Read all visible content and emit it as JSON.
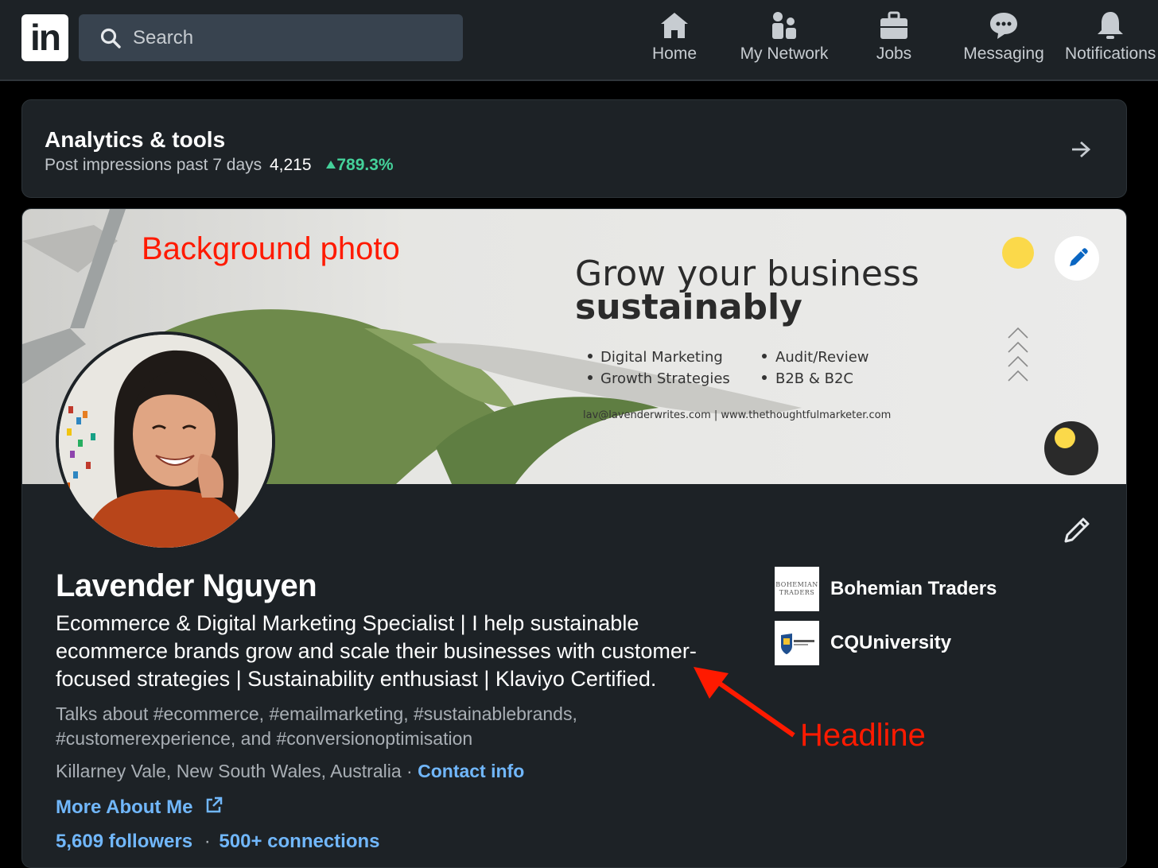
{
  "nav": {
    "logo_text": "in",
    "search_placeholder": "Search",
    "items": [
      {
        "label": "Home",
        "icon": "home-icon"
      },
      {
        "label": "My Network",
        "icon": "network-icon"
      },
      {
        "label": "Jobs",
        "icon": "briefcase-icon"
      },
      {
        "label": "Messaging",
        "icon": "chat-icon"
      },
      {
        "label": "Notifications",
        "icon": "bell-icon"
      }
    ]
  },
  "analytics": {
    "title": "Analytics & tools",
    "impressions_label": "Post impressions past 7 days",
    "impressions_value": "4,215",
    "impressions_change": "789.3%"
  },
  "banner": {
    "heading_line1": "Grow your business",
    "heading_line2": "sustainably",
    "services": [
      "Digital Marketing",
      "Growth Strategies",
      "Audit/Review",
      "B2B & B2C"
    ],
    "contact_line": "lav@lavenderwrites.com  | www.thethoughtfulmarketer.com"
  },
  "profile": {
    "name": "Lavender Nguyen",
    "headline": "Ecommerce & Digital Marketing Specialist | I help sustainable ecommerce brands grow and scale their businesses with customer-focused strategies | Sustainability enthusiast | Klaviyo Certified.",
    "talks_about": "Talks about #ecommerce, #emailmarketing, #sustainablebrands, #customerexperience, and #conversionoptimisation",
    "location": "Killarney Vale, New South Wales, Australia",
    "location_sep": "·",
    "contact_info": "Contact info",
    "more_about": "More About Me",
    "followers": "5,609 followers",
    "connections_sep": "·",
    "connections": "500+ connections",
    "organizations": [
      {
        "name": "Bohemian Traders",
        "logo_text": "BOHEMIAN TRADERS"
      },
      {
        "name": "CQUniversity",
        "logo_text": "CQ University"
      }
    ]
  },
  "annotations": {
    "background": "Background photo",
    "headline": "Headline"
  },
  "colors": {
    "link": "#71b7fb",
    "positive": "#44d19a",
    "annotation": "#ff1a00"
  }
}
